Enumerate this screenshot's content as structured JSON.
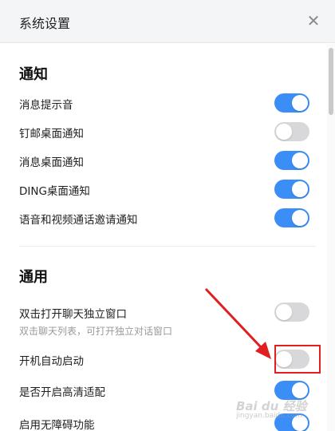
{
  "window": {
    "title": "系统设置"
  },
  "sections": {
    "notify": {
      "title": "通知",
      "items": [
        {
          "label": "消息提示音",
          "state": "on"
        },
        {
          "label": "钉邮桌面通知",
          "state": "off"
        },
        {
          "label": "消息桌面通知",
          "state": "on"
        },
        {
          "label": "DING桌面通知",
          "state": "on"
        },
        {
          "label": "语音和视频通话邀请通知",
          "state": "on"
        }
      ]
    },
    "general": {
      "title": "通用",
      "items": [
        {
          "label": "双击打开聊天独立窗口",
          "sub": "双击聊天列表，可打开独立对话窗口",
          "state": "off"
        },
        {
          "label": "开机自动启动",
          "state": "off"
        },
        {
          "label": "是否开启高清适配",
          "state": "on"
        },
        {
          "label": "启用无障碍功能",
          "state": "on"
        }
      ]
    }
  },
  "watermark": {
    "brand": "Bai du 经验",
    "sub": "jingyan.baidu.com"
  },
  "colors": {
    "toggle_on": "#3a8ef6",
    "toggle_off": "#d8d8da",
    "highlight": "#e02020"
  },
  "icons": {
    "close": "close-icon"
  }
}
